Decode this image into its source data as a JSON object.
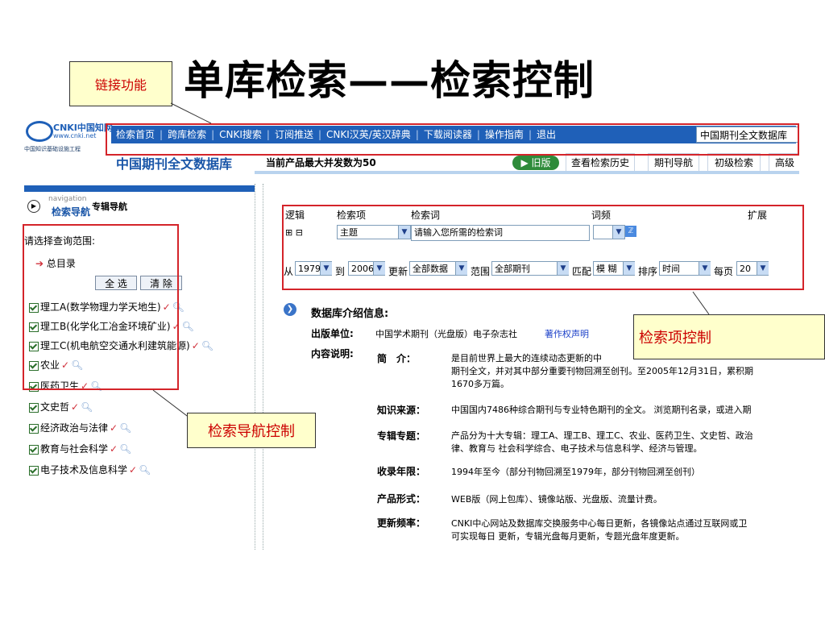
{
  "slide": {
    "title": "单库检索——检索控制",
    "callout_link": "链接功能",
    "callout_search_items": "检索项控制",
    "callout_nav": "检索导航控制"
  },
  "header": {
    "logo_text": "CNKI中国知网",
    "logo_url": "www.cnki.net",
    "logo_sub": "中国知识基础设施工程",
    "nav_items": [
      "检索首页",
      "跨库检索",
      "CNKI搜索",
      "订阅推送",
      "CNKI汉英/英汉辞典",
      "下载阅读器",
      "操作指南",
      "退出"
    ],
    "db_select": "中国期刊全文数据库",
    "db_title": "中国期刊全文数据库",
    "concurrency": "当前产品最大并发数为50",
    "old_version": "旧版",
    "tabs": [
      "查看检索历史",
      "期刊导航",
      "初级检索",
      "高级"
    ]
  },
  "left_nav": {
    "navigation_small": "navigation",
    "title": "检索导航",
    "title2": "专辑导航",
    "range_label": "请选择查询范围:",
    "root": "总目录",
    "select_all": "全 选",
    "clear": "清 除",
    "items": [
      "理工A(数学物理力学天地生)",
      "理工B(化学化工冶金环境矿业)",
      "理工C(机电航空交通水利建筑能源)",
      "农业",
      "医药卫生",
      "文史哲",
      "经济政治与法律",
      "教育与社会科学",
      "电子技术及信息科学"
    ]
  },
  "search": {
    "headers": {
      "logic": "逻辑",
      "field": "检索项",
      "term": "检索词",
      "freq": "词频",
      "expand": "扩展"
    },
    "logic_symbols": "⊞ ⊟",
    "field_value": "主题",
    "term_placeholder": "请输入您所需的检索词",
    "from_label": "从",
    "from_year": "1979",
    "to_label": "到",
    "to_year": "2006",
    "update_label": "更新",
    "update_value": "全部数据",
    "range_label": "范围",
    "range_value": "全部期刊",
    "match_label": "匹配",
    "match_value": "模 糊",
    "sort_label": "排序",
    "sort_value": "时间",
    "page_label": "每页",
    "page_value": "20"
  },
  "intro": {
    "title": "数据库介绍信息:",
    "publisher_label": "出版单位:",
    "publisher_value": "中国学术期刊（光盘版）电子杂志社",
    "copyright_link": "著作权声明",
    "content_label": "内容说明:",
    "rows": [
      {
        "key": "简　介：",
        "lines": [
          "是目前世界上最大的连续动态更新的中",
          "期刊全文，并对其中部分重要刊物回溯至创刊。至2005年12月31日，累积期",
          "1670多万篇。"
        ]
      },
      {
        "key": "知识来源：",
        "lines": [
          "中国国内7486种综合期刊与专业特色期刊的全文。 浏览期刊名录，或进入期"
        ]
      },
      {
        "key": "专辑专题：",
        "lines": [
          "产品分为十大专辑：理工A、理工B、理工C、农业、医药卫生、文史哲、政治",
          "律、教育与 社会科学综合、电子技术与信息科学、经济与管理。"
        ]
      },
      {
        "key": "收录年限：",
        "lines": [
          "1994年至今（部分刊物回溯至1979年，部分刊物回溯至创刊）"
        ]
      },
      {
        "key": "产品形式：",
        "lines": [
          "WEB版（网上包库）、镜像站版、光盘版、流量计费。"
        ]
      },
      {
        "key": "更新频率：",
        "lines": [
          "CNKI中心网站及数据库交换服务中心每日更新，各镜像站点通过互联网或卫",
          "可实现每日 更新，专辑光盘每月更新，专题光盘年度更新。"
        ]
      }
    ]
  }
}
